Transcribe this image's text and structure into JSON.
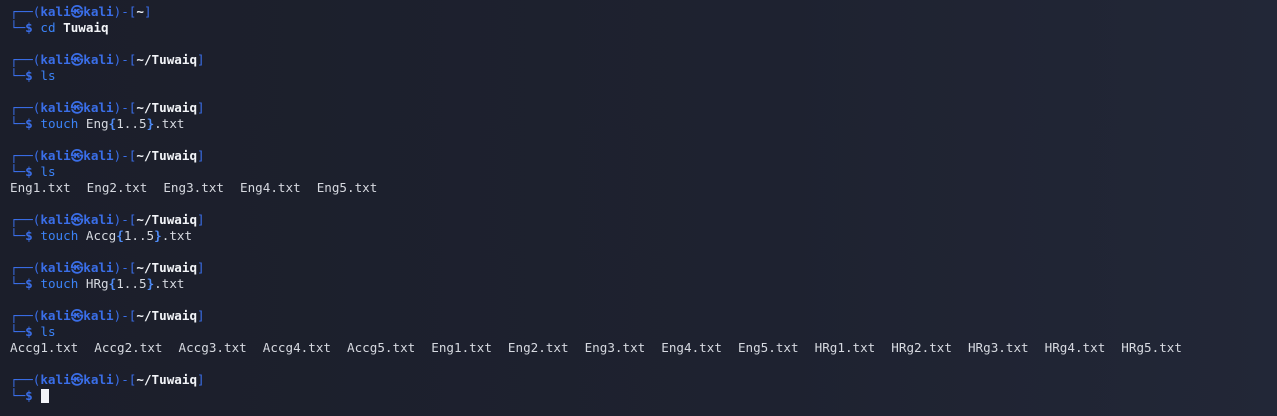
{
  "prompt": {
    "frame_top_left": "┌──(",
    "user": "kali",
    "skull": "㉿",
    "host": "kali",
    "frame_mid": ")-[",
    "frame_close": "]",
    "frame_bottom": "└─",
    "dollar": "$"
  },
  "blocks": [
    {
      "path": "~",
      "cmd": "cd",
      "args": [
        {
          "t": "Tuwaiq",
          "bold": true
        }
      ],
      "output": []
    },
    {
      "path": "~/Tuwaiq",
      "cmd": "ls",
      "args": [],
      "output": []
    },
    {
      "path": "~/Tuwaiq",
      "cmd": "touch",
      "args": [
        {
          "t": "Eng"
        },
        {
          "t": "{",
          "brace": true
        },
        {
          "t": "1..5"
        },
        {
          "t": "}",
          "brace": true
        },
        {
          "t": ".txt"
        }
      ],
      "output": []
    },
    {
      "path": "~/Tuwaiq",
      "cmd": "ls",
      "args": [],
      "output": [
        "Eng1.txt",
        "Eng2.txt",
        "Eng3.txt",
        "Eng4.txt",
        "Eng5.txt"
      ]
    },
    {
      "path": "~/Tuwaiq",
      "cmd": "touch",
      "args": [
        {
          "t": "Accg"
        },
        {
          "t": "{",
          "brace": true
        },
        {
          "t": "1..5"
        },
        {
          "t": "}",
          "brace": true
        },
        {
          "t": ".txt"
        }
      ],
      "output": []
    },
    {
      "path": "~/Tuwaiq",
      "cmd": "touch",
      "args": [
        {
          "t": "HRg"
        },
        {
          "t": "{",
          "brace": true
        },
        {
          "t": "1..5"
        },
        {
          "t": "}",
          "brace": true
        },
        {
          "t": ".txt"
        }
      ],
      "output": []
    },
    {
      "path": "~/Tuwaiq",
      "cmd": "ls",
      "args": [],
      "output": [
        "Accg1.txt",
        "Accg2.txt",
        "Accg3.txt",
        "Accg4.txt",
        "Accg5.txt",
        "Eng1.txt",
        "Eng2.txt",
        "Eng3.txt",
        "Eng4.txt",
        "Eng5.txt",
        "HRg1.txt",
        "HRg2.txt",
        "HRg3.txt",
        "HRg4.txt",
        "HRg5.txt"
      ]
    },
    {
      "path": "~/Tuwaiq",
      "cmd": "",
      "args": [],
      "output": [],
      "cursor": true
    }
  ],
  "colors": {
    "background": "#1c1f2b",
    "accent": "#3a6ee8",
    "command": "#3b82f6",
    "text": "#d6d9e0"
  }
}
